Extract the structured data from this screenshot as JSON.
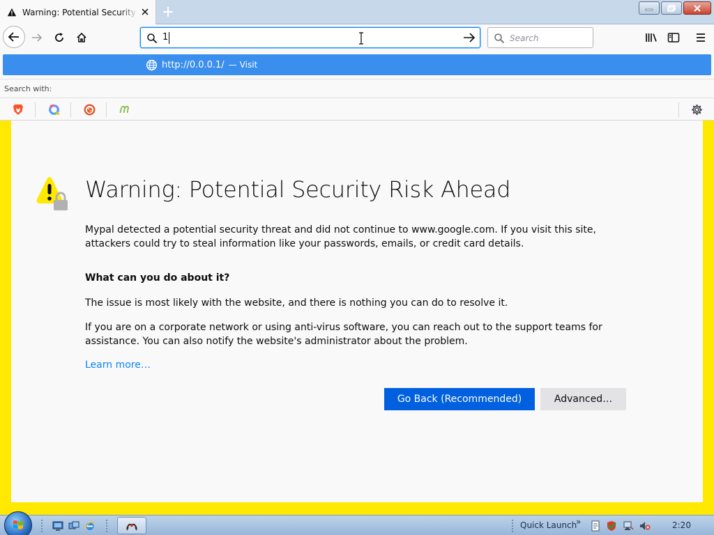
{
  "browser": {
    "tab": {
      "title": "Warning: Potential Security Risk Ahead",
      "icon": "warning-icon"
    },
    "window_controls": [
      "minimize-icon",
      "restore-icon",
      "close-icon"
    ],
    "url_input": {
      "value": "1"
    },
    "search_box": {
      "placeholder": "Search"
    },
    "toolbar_icons": [
      "library-icon",
      "sidebar-icon",
      "menu-icon"
    ]
  },
  "autocomplete": {
    "suggestion": {
      "url": "http://0.0.0.1/",
      "separator": "—",
      "action": "Visit"
    },
    "search_with_label": "Search with:",
    "engines": [
      "brave-icon",
      "qwant-icon",
      "duckduckgo-icon",
      "mojeek-icon"
    ]
  },
  "page": {
    "title": "Warning: Potential Security Risk Ahead",
    "intro": "Mypal detected a potential security threat and did not continue to www.google.com. If you visit this site, attackers could try to steal information like your passwords, emails, or credit card details.",
    "subheading": "What can you do about it?",
    "para1": "The issue is most likely with the website, and there is nothing you can do to resolve it.",
    "para2": "If you are on a corporate network or using anti-virus software, you can reach out to the support teams for assistance. You can also notify the website's administrator about the problem.",
    "learn_more": "Learn more…",
    "go_back": "Go Back (Recommended)",
    "advanced": "Advanced…",
    "accent_color": "#0060df",
    "border_color": "#ffe900"
  },
  "taskbar": {
    "quick_launch": "Quick Launch",
    "chevron": "»",
    "clock": "2:20"
  }
}
